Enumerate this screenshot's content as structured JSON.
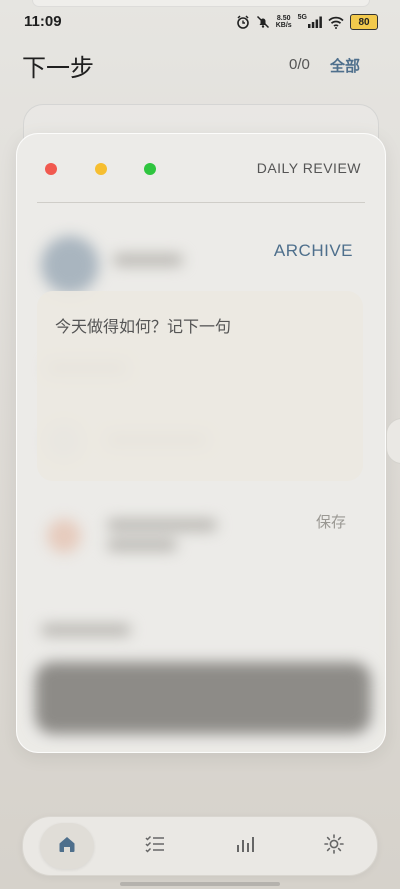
{
  "status_bar": {
    "time": "11:09",
    "net_speed_value": "8.50",
    "net_speed_unit": "KB/s",
    "network": "5G",
    "battery": "80",
    "icons": [
      "alarm-icon",
      "bell-off-icon",
      "signal-icon",
      "wifi-icon",
      "battery-icon"
    ]
  },
  "header": {
    "title": "下一步",
    "count": "0/0",
    "filter_label": "全部"
  },
  "card": {
    "label": "DAILY REVIEW",
    "archive_label": "ARCHIVE",
    "note_placeholder": "今天做得如何？记下一句",
    "save_label": "保存",
    "window_dots": [
      "#f1594f",
      "#f6be30",
      "#2fc53f"
    ]
  },
  "nav": {
    "items": [
      {
        "icon": "home-icon",
        "active": true
      },
      {
        "icon": "tasks-icon",
        "active": false
      },
      {
        "icon": "stats-icon",
        "active": false
      },
      {
        "icon": "settings-icon",
        "active": false
      }
    ]
  },
  "colors": {
    "accent": "#4e6f8c",
    "background": "#e1dfdb"
  }
}
